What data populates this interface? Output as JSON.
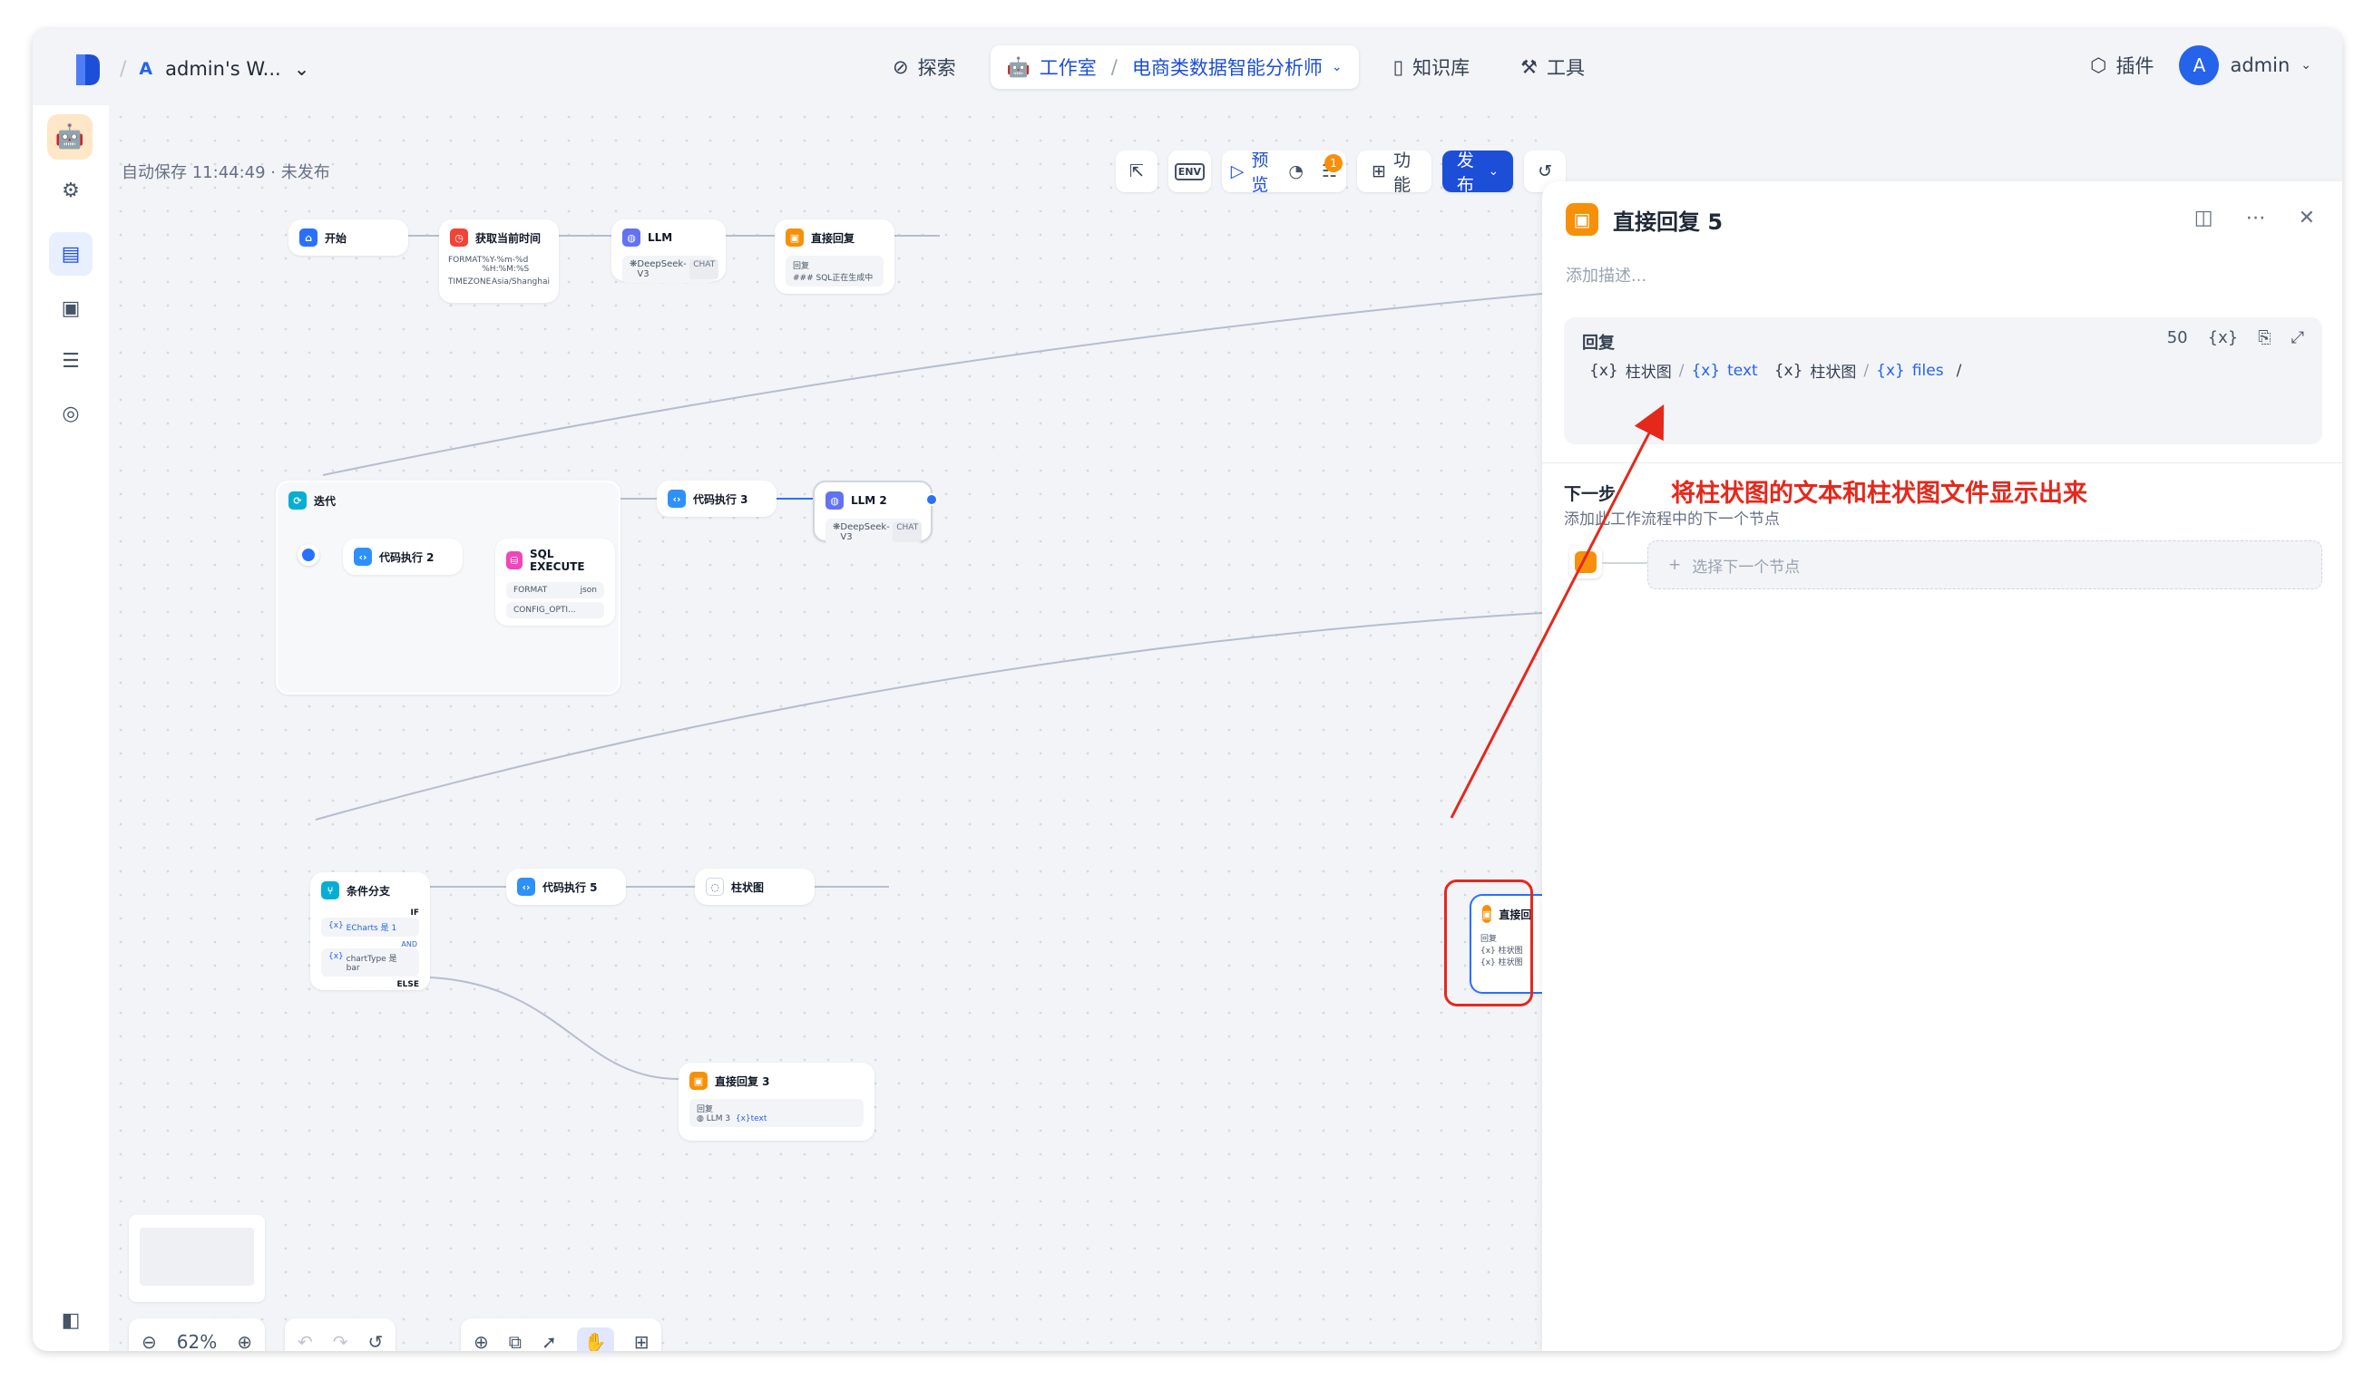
{
  "topbar": {
    "workspace_icon": "A",
    "workspace_name": "admin's W...",
    "nav": {
      "explore": "探索",
      "studio": "工作室",
      "app_name": "电商类数据智能分析师",
      "knowledge": "知识库",
      "tools": "工具"
    },
    "plugins": "插件",
    "avatar_letter": "A",
    "user": "admin"
  },
  "canvas": {
    "autosave": "自动保存 11:44:49 · 未发布",
    "toolbar": {
      "env": "ENV",
      "preview": "预览",
      "checklist_badge": "1",
      "features": "功能",
      "publish": "发布"
    },
    "zoom": "62%"
  },
  "nodes": {
    "start": {
      "title": "开始"
    },
    "get_time": {
      "title": "获取当前时间",
      "format_label": "FORMAT",
      "format_value": "%Y-%m-%d %H:%M:%S",
      "tz_label": "TIMEZONE",
      "tz_value": "Asia/Shanghai"
    },
    "llm1": {
      "title": "LLM",
      "model": "DeepSeek-V3",
      "mode": "CHAT"
    },
    "reply1": {
      "title": "直接回复",
      "label": "回复",
      "text": "### SQL正在生成中"
    },
    "iteration": {
      "title": "迭代"
    },
    "code2": {
      "title": "代码执行 2"
    },
    "sql": {
      "title": "SQL EXECUTE",
      "format_label": "FORMAT",
      "format_value": "json",
      "config_label": "CONFIG_OPTI..."
    },
    "code3": {
      "title": "代码执行 3"
    },
    "llm2": {
      "title": "LLM 2",
      "model": "DeepSeek-V3",
      "mode": "CHAT"
    },
    "condition": {
      "title": "条件分支",
      "if_label": "IF",
      "cond1": "ECharts 是 1",
      "cond2": "chartType 是 bar",
      "and_label": "AND",
      "else_label": "ELSE"
    },
    "code5": {
      "title": "代码执行 5"
    },
    "barchart": {
      "title": "柱状图"
    },
    "reply5_partial": {
      "title": "直接回",
      "label": "回复",
      "v1": "{x} 柱状图",
      "v2": "{x} 柱状图"
    },
    "reply3": {
      "title": "直接回复 3",
      "label": "回复",
      "llm": "LLM 3",
      "var": "text"
    }
  },
  "panel": {
    "title": "直接回复 5",
    "description_placeholder": "添加描述...",
    "reply_label": "回复",
    "char_count": "50",
    "var_btn": "{x}",
    "vars": {
      "a_node": "柱状图",
      "a_var": "text",
      "b_node": "柱状图",
      "b_var": "files"
    },
    "next_title": "下一步",
    "next_desc": "添加此工作流程中的下一个节点",
    "next_select": "选择下一个节点"
  },
  "annotation": "将柱状图的文本和柱状图文件显示出来",
  "colors": {
    "accent": "#1d4ed8",
    "annotation_red": "#e5281c",
    "reply_orange": "#f79009"
  }
}
